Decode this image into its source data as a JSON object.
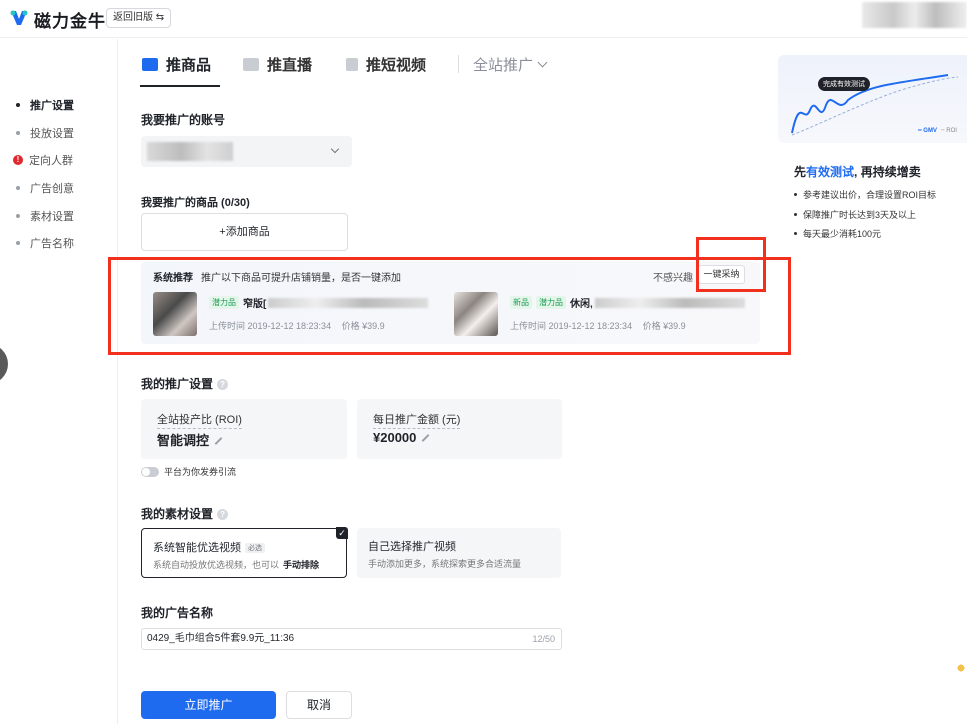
{
  "header": {
    "brand": "磁力金牛",
    "old_version_button": "返回旧版 ⇆"
  },
  "sidenav": {
    "items": [
      {
        "label": "推广设置",
        "state": "active"
      },
      {
        "label": "投放设置",
        "state": "normal"
      },
      {
        "label": "定向人群",
        "state": "error"
      },
      {
        "label": "广告创意",
        "state": "normal"
      },
      {
        "label": "素材设置",
        "state": "normal"
      },
      {
        "label": "广告名称",
        "state": "normal"
      }
    ]
  },
  "tabs": {
    "items": [
      {
        "label": "推商品",
        "icon": "megaphone-icon"
      },
      {
        "label": "推直播",
        "icon": "video-icon"
      },
      {
        "label": "推短视频",
        "icon": "clip-icon"
      }
    ],
    "dropdown_label": "全站推广"
  },
  "account": {
    "title": "我要推广的账号"
  },
  "goods": {
    "title": "我要推广的商品 (0/30)",
    "add_label": "+添加商品"
  },
  "recommend": {
    "title": "系统推荐",
    "subtitle": "推广以下商品可提升店铺销量，是否一键添加",
    "not_interested": "不感兴趣",
    "adopt_button": "一键采纳",
    "products": [
      {
        "tags": [
          "潜力品"
        ],
        "title_prefix": "窄版[",
        "upload_time": "上传时间 2019-12-12 18:23:34",
        "price": "价格 ¥39.9"
      },
      {
        "tags": [
          "新品",
          "潜力品"
        ],
        "title_prefix": "休闲,",
        "upload_time": "上传时间 2019-12-12 18:23:34",
        "price": "价格 ¥39.9"
      }
    ]
  },
  "promo": {
    "title": "我的推广设置",
    "roi_label": "全站投产比 (ROI)",
    "roi_value": "智能调控",
    "budget_label": "每日推广金额 (元)",
    "budget_value": "¥20000",
    "coupon_toggle_label": "平台为你发券引流",
    "coupon_toggle_on": false
  },
  "material": {
    "title": "我的素材设置",
    "option1_title": "系统智能优选视频",
    "option1_badge": "必选",
    "option1_desc": "系统自动投放优选视频，也可以",
    "option1_link": "手动排除",
    "option2_title": "自己选择推广视频",
    "option2_desc": "手动添加更多，系统探索更多合适流量"
  },
  "ad_name": {
    "title": "我的广告名称",
    "value": "0429_毛巾组合5件套9.9元_11:36",
    "count": "12/50"
  },
  "actions": {
    "submit": "立即推广",
    "cancel": "取消"
  },
  "right_panel": {
    "bubble": "完成有效测试",
    "legend_gmv": "━ GMV",
    "legend_roi": "╌ ROI",
    "title_prefix": "先",
    "title_highlight": "有效测试",
    "title_suffix": ", 再持续增卖",
    "tips": [
      "参考建议出价，合理设置ROI目标",
      "保障推广时长达到3天及以上",
      "每天最少消耗100元"
    ]
  },
  "colors": {
    "primary": "#1e6bf0",
    "annotation_red": "#f2301e",
    "error": "#e0282e"
  }
}
